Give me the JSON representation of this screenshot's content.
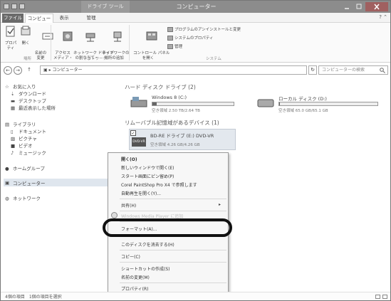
{
  "window": {
    "title": "コンピューター",
    "context_tab": "ドライブ ツール"
  },
  "tabs": {
    "file": "ファイル",
    "computer": "コンピューター",
    "view": "表示",
    "manage": "管理"
  },
  "ribbon": {
    "properties": "プロパティ",
    "open": "開く",
    "rename": "名前の\n変更",
    "access_media": "アクセス\nメディア・",
    "map_network_drive": "ネットワーク ドライブ\nの割り当て・",
    "add_network_location": "ネットワークの\n場所の追加",
    "control_panel": "コントロール パネル\nを開く",
    "uninstall": "プログラムのアンインストールと変更",
    "system_properties": "システムのプロパティ",
    "manage": "管理",
    "group_location": "場所",
    "group_network": "ネットワーク",
    "group_system": "システム"
  },
  "address": {
    "path": "コンピューター",
    "search_placeholder": "コンピューターの検索"
  },
  "nav": {
    "favorites": "お気に入り",
    "downloads": "ダウンロード",
    "desktop": "デスクトップ",
    "recent": "最近表示した場所",
    "libraries": "ライブラリ",
    "documents": "ドキュメント",
    "pictures": "ピクチャ",
    "videos": "ビデオ",
    "music": "ミュージック",
    "homegroup": "ホームグループ",
    "computer": "コンピューター",
    "network": "ネットワーク"
  },
  "content": {
    "hdd_group": "ハード ディスク ドライブ (2)",
    "removable_group": "リムーバブル記憶域があるデバイス (1)",
    "drive_c": {
      "name": "Windows 8 (C:)",
      "space": "空き領域 2.50 TB/2.64 TB",
      "used_fraction": 0.05
    },
    "drive_d": {
      "name": "ローカル ディスク (D:)",
      "space": "空き領域 65.0 GB/65.1 GB",
      "used_fraction": 0.01
    },
    "drive_e": {
      "name": "BD-RE ドライブ (E:) DVD-VR",
      "space": "空き領域 4.26 GB/4.26 GB",
      "icon_label": "DVD-VR"
    }
  },
  "context_menu": {
    "open": "開く(O)",
    "open_new_window": "新しいウィンドウで開く(E)",
    "pin_start": "スタート画面にピン留め(P)",
    "corel": "Corel PaintShop Pro X4 で参照します",
    "autoplay": "自動再生を開く(Y)...",
    "share": "共有(H)",
    "share_arrow": "▸",
    "hidden_item": "Windows Media Player に追加",
    "format": "フォーマット(A)...",
    "eject": "このディスクを消去する(H)",
    "copy": "コピー(C)",
    "create_shortcut": "ショートカットの作成(S)",
    "rename": "名前の変更(M)",
    "properties": "プロパティ(R)"
  },
  "status": {
    "text": "4個の項目　1個の項目を選択"
  },
  "help": "? ⌃"
}
